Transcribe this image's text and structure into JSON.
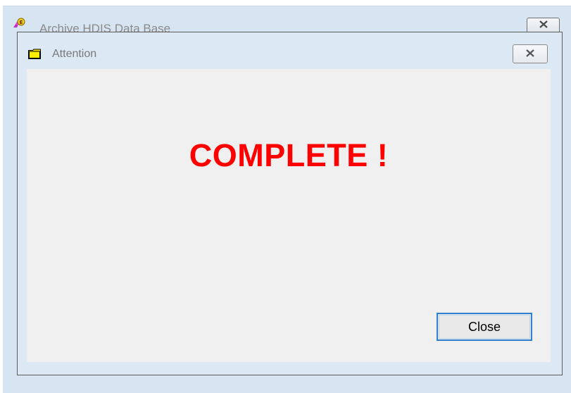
{
  "outer_window": {
    "title": "Archive HDIS Data Base",
    "icon": "app-icon",
    "close_icon": "close-icon"
  },
  "dialog": {
    "title": "Attention",
    "icon": "folder-icon",
    "close_icon": "close-icon",
    "message": "COMPLETE !",
    "close_button_label": "Close"
  },
  "colors": {
    "message": "#ff0000",
    "focus_border": "#2e7fd0",
    "window_frame": "#d7e4f2",
    "client_bg": "#f0f0f0"
  }
}
